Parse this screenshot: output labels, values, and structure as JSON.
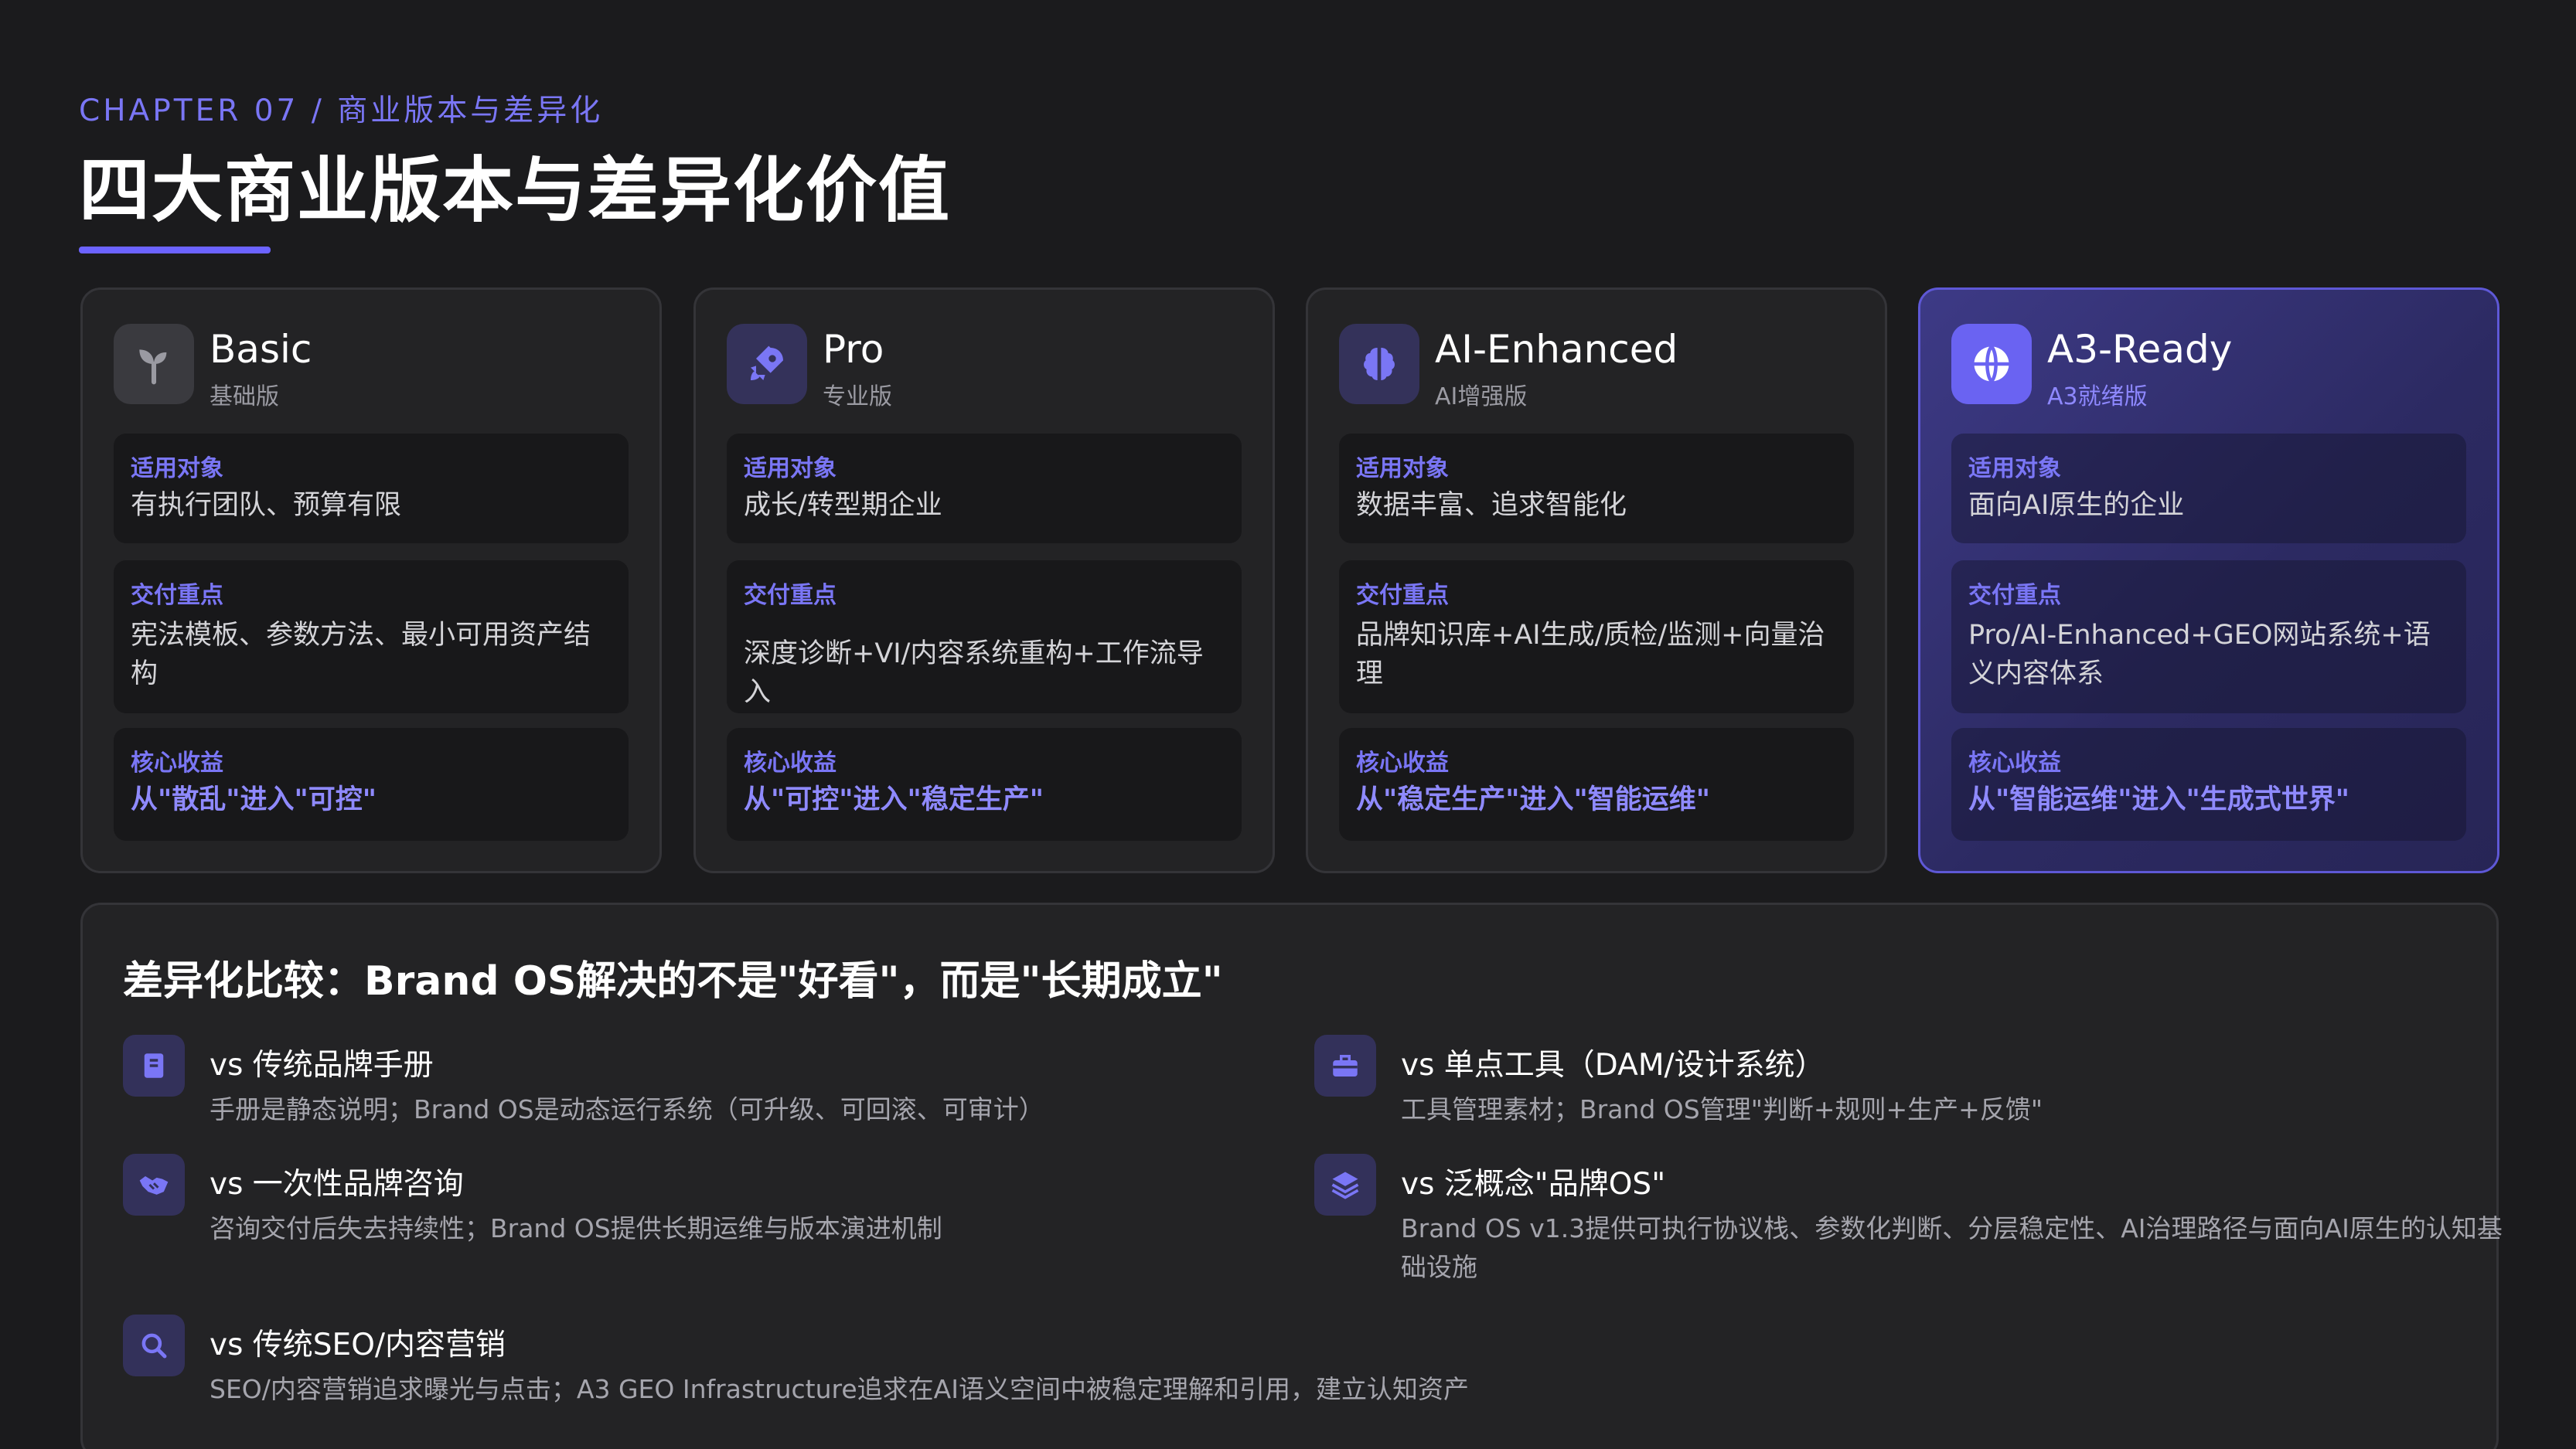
{
  "header": {
    "eyebrow": "CHAPTER 07 / 商业版本与差异化",
    "title": "四大商业版本与差异化价值"
  },
  "colors": {
    "accent": "#6c63ff",
    "background": "#1b1b1d",
    "card": "#232325",
    "highlight_card": "#3d3a86"
  },
  "cards": [
    {
      "name": "Basic",
      "subtitle": "基础版",
      "icon": "sprout-icon",
      "target_label": "适用对象",
      "target": "有执行团队、预算有限",
      "delivery_label": "交付重点",
      "delivery": "宪法模板、参数方法、最小可用资产结构",
      "benefit_label": "核心收益",
      "benefit": "从\"散乱\"进入\"可控\""
    },
    {
      "name": "Pro",
      "subtitle": "专业版",
      "icon": "rocket-icon",
      "target_label": "适用对象",
      "target": "成长/转型期企业",
      "delivery_label": "交付重点",
      "delivery": "深度诊断+VI/内容系统重构+工作流导入",
      "benefit_label": "核心收益",
      "benefit": "从\"可控\"进入\"稳定生产\""
    },
    {
      "name": "AI-Enhanced",
      "subtitle": "AI增强版",
      "icon": "brain-icon",
      "target_label": "适用对象",
      "target": "数据丰富、追求智能化",
      "delivery_label": "交付重点",
      "delivery": "品牌知识库+AI生成/质检/监测+向量治理",
      "benefit_label": "核心收益",
      "benefit": "从\"稳定生产\"进入\"智能运维\""
    },
    {
      "name": "A3-Ready",
      "subtitle": "A3就绪版",
      "icon": "globe-icon",
      "target_label": "适用对象",
      "target": "面向AI原生的企业",
      "delivery_label": "交付重点",
      "delivery": "Pro/AI-Enhanced+GEO网站系统+语义内容体系",
      "benefit_label": "核心收益",
      "benefit": "从\"智能运维\"进入\"生成式世界\""
    }
  ],
  "compare": {
    "title": "差异化比较：Brand OS解决的不是\"好看\"，而是\"长期成立\"",
    "items": [
      {
        "icon": "book-icon",
        "title": "vs 传统品牌手册",
        "desc": "手册是静态说明；Brand OS是动态运行系统（可升级、可回滚、可审计）"
      },
      {
        "icon": "toolbox-icon",
        "title": "vs 单点工具（DAM/设计系统）",
        "desc": "工具管理素材；Brand OS管理\"判断+规则+生产+反馈\""
      },
      {
        "icon": "handshake-icon",
        "title": "vs 一次性品牌咨询",
        "desc": "咨询交付后失去持续性；Brand OS提供长期运维与版本演进机制"
      },
      {
        "icon": "layers-icon",
        "title": "vs 泛概念\"品牌OS\"",
        "desc": "Brand OS v1.3提供可执行协议栈、参数化判断、分层稳定性、AI治理路径与面向AI原生的认知基础设施"
      },
      {
        "icon": "search-icon",
        "title": "vs 传统SEO/内容营销",
        "desc": "SEO/内容营销追求曝光与点击；A3 GEO Infrastructure追求在AI语义空间中被稳定理解和引用，建立认知资产"
      }
    ]
  }
}
